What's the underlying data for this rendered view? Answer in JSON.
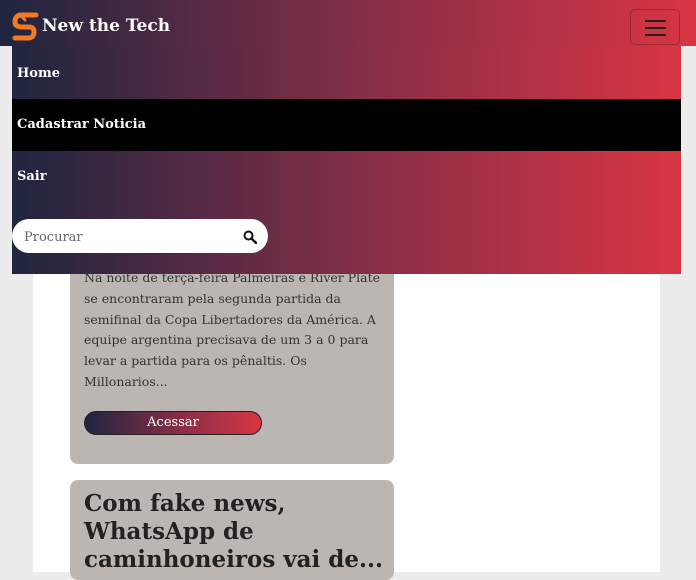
{
  "navbar": {
    "brand": "New the Tech",
    "colors": {
      "gradient_start": "#1f2540",
      "gradient_mid": "#8a2e47",
      "gradient_end": "#d93544",
      "logo": "#f07b22"
    }
  },
  "menu": {
    "items": [
      {
        "label": "Home"
      },
      {
        "label": "Cadastrar Noticia"
      },
      {
        "label": "Sair"
      }
    ],
    "active_item": "Cadastrar Noticia"
  },
  "search": {
    "placeholder": "Procurar"
  },
  "cards": [
    {
      "excerpt": "Na noite de terça-feira Palmeiras e River Plate se encontraram pela segunda partida da semifinal da Copa Libertadores da América. A equipe argentina precisava de um 3 a 0 para levar a partida para os pênaltis. Os Millonarios...",
      "button_label": "Acessar"
    },
    {
      "title": "Com fake news, WhatsApp de caminhoneiros vai de..."
    }
  ]
}
